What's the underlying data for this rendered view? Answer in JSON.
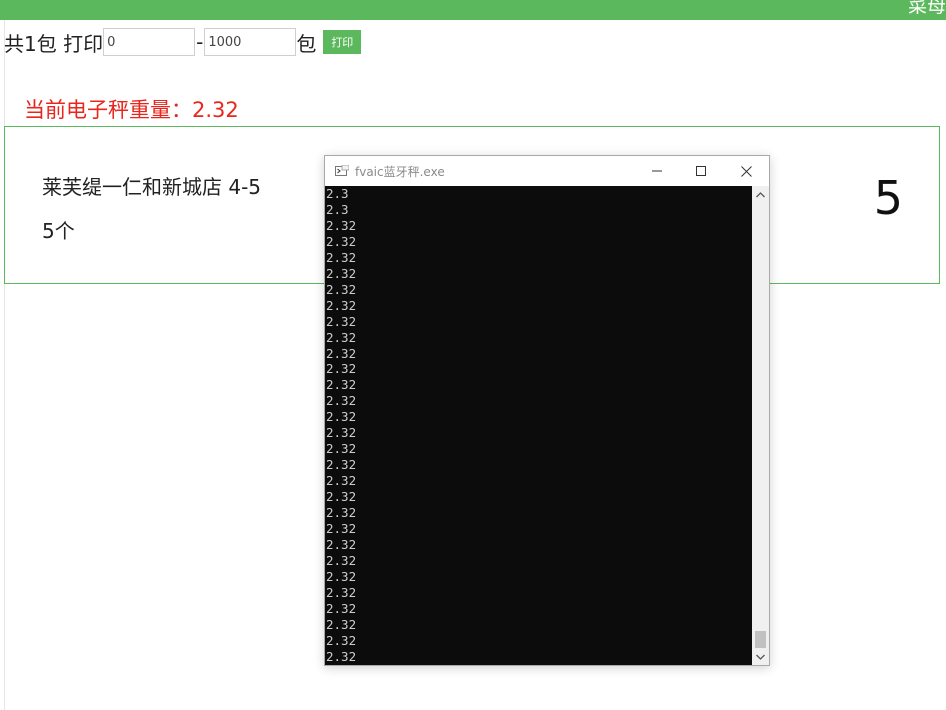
{
  "header": {
    "label": "菜母"
  },
  "print_form": {
    "total_label": "共1包 打印",
    "from_value": "0",
    "separator": "-",
    "to_value": "1000",
    "unit_label": "包",
    "print_button": "打印"
  },
  "scale": {
    "weight_text": "当前电子秤重量：2.32"
  },
  "package_card": {
    "line1": "莱芙缇一仁和新城店 4-5",
    "line2": "5个",
    "big_number": "5"
  },
  "console": {
    "title": "fvaic蓝牙秤.exe",
    "lines": [
      "2.3",
      "2.3",
      "2.32",
      "2.32",
      "2.32",
      "2.32",
      "2.32",
      "2.32",
      "2.32",
      "2.32",
      "2.32",
      "2.32",
      "2.32",
      "2.32",
      "2.32",
      "2.32",
      "2.32",
      "2.32",
      "2.32",
      "2.32",
      "2.32",
      "2.32",
      "2.32",
      "2.32",
      "2.32",
      "2.32",
      "2.32",
      "2.32",
      "2.32",
      "2.32"
    ]
  },
  "colors": {
    "accent_green": "#5cb85c",
    "weight_red": "#e8261e",
    "console_bg": "#0c0c0c"
  },
  "icons": [
    "console-app-icon",
    "minimize-icon",
    "maximize-icon",
    "close-icon",
    "scroll-up-arrow-icon",
    "scroll-down-arrow-icon"
  ]
}
